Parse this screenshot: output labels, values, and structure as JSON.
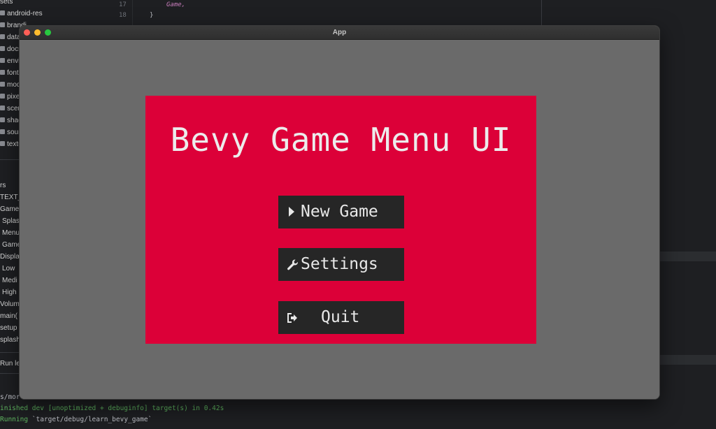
{
  "ide": {
    "tree_items": [
      {
        "label": "sets",
        "folder": false
      },
      {
        "label": "android-res",
        "folder": true
      },
      {
        "label": "brandi",
        "folder": true
      },
      {
        "label": "data",
        "folder": true
      },
      {
        "label": "docs",
        "folder": true
      },
      {
        "label": "envir",
        "folder": true
      },
      {
        "label": "fonts",
        "folder": true
      },
      {
        "label": "mode",
        "folder": true
      },
      {
        "label": "pixel",
        "folder": true
      },
      {
        "label": "scene",
        "folder": true
      },
      {
        "label": "shade",
        "folder": true
      },
      {
        "label": "soun",
        "folder": true
      },
      {
        "label": "textu",
        "folder": true
      }
    ],
    "structure_items": [
      {
        "label": "rs"
      },
      {
        "label": "TEXT_"
      },
      {
        "label": "Game"
      },
      {
        "label": "Splas"
      },
      {
        "label": "Menu"
      },
      {
        "label": "Game"
      },
      {
        "label": "Displa"
      },
      {
        "label": "Low"
      },
      {
        "label": "Medi"
      },
      {
        "label": "High"
      },
      {
        "label": "Volum"
      },
      {
        "label": "main("
      },
      {
        "label": "setup"
      },
      {
        "label": "splash"
      }
    ],
    "run_tab_label": "Run le",
    "editor": {
      "line_17": "17",
      "line_18": "18",
      "code_17": "Game,",
      "code_18": "}"
    },
    "terminal": {
      "line_1": "s/mor",
      "line_2": "inished dev [unoptimized + debuginfo] target(s) in 0.42s",
      "line_3_prefix": "Running ",
      "line_3_path": "`target/debug/learn_bevy_game`"
    }
  },
  "window": {
    "title": "App"
  },
  "menu": {
    "title": "Bevy Game Menu UI",
    "buttons": {
      "new_game": "New Game",
      "settings": "Settings",
      "quit": "Quit"
    }
  },
  "colors": {
    "panel": "#dc0038",
    "button": "#262626",
    "viewport": "#6a6a6a",
    "text": "#ececec"
  }
}
